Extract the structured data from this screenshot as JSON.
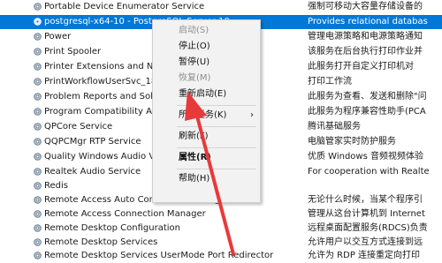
{
  "services": [
    {
      "name": "Portable Device Enumerator Service",
      "desc": "强制可移动大容量存储设备的",
      "selected": false
    },
    {
      "name": "postgresql-x64-10 - PostgreSQL Server 10",
      "desc": "Provides relational databas",
      "selected": true
    },
    {
      "name": "Power",
      "desc": "管理电源策略和电源策略通知",
      "selected": false
    },
    {
      "name": "Print Spooler",
      "desc": "该服务在后台执行打印作业并",
      "selected": false
    },
    {
      "name": "Printer Extensions and Notifications",
      "desc": "此服务打开自定义打印机对",
      "selected": false
    },
    {
      "name": "PrintWorkflowUserSvc_183e",
      "desc": "打印工作流",
      "selected": false
    },
    {
      "name": "Problem Reports and Solutions Control Panel",
      "desc": "此服务为查看、发送和删除\"问",
      "selected": false
    },
    {
      "name": "Program Compatibility Assistant Service",
      "desc": "此服务为程序兼容性助手(PCA",
      "selected": false
    },
    {
      "name": "QPCore Service",
      "desc": "腾讯基础服务",
      "selected": false
    },
    {
      "name": "QQPCMgr RTP Service",
      "desc": "电脑管家实时防护服务",
      "selected": false
    },
    {
      "name": "Quality Windows Audio Video Experience",
      "desc": "优质 Windows 音频视频体验",
      "selected": false
    },
    {
      "name": "Realtek Audio Service",
      "desc": "For cooperation with Realte",
      "selected": false
    },
    {
      "name": "Redis",
      "desc": "",
      "selected": false
    },
    {
      "name": "Remote Access Auto Connection Manager",
      "desc": "无论什么时候，当某个程序引",
      "selected": false
    },
    {
      "name": "Remote Access Connection Manager",
      "desc": "管理从这台计算机到 Internet",
      "selected": false
    },
    {
      "name": "Remote Desktop Configuration",
      "desc": "远程桌面配置服务(RDCS)负责",
      "selected": false
    },
    {
      "name": "Remote Desktop Services",
      "desc": "允许用户以交互方式连接到远",
      "selected": false
    },
    {
      "name": "Remote Desktop Services UserMode Port Redirector",
      "desc": "允许为 RDP 连接重定向打印",
      "selected": false
    }
  ],
  "context_menu": {
    "items": [
      {
        "label": "启动(S)",
        "disabled": true,
        "bold": false,
        "submenu": false
      },
      {
        "label": "停止(O)",
        "disabled": false,
        "bold": false,
        "submenu": false
      },
      {
        "label": "暂停(U)",
        "disabled": false,
        "bold": false,
        "submenu": false
      },
      {
        "label": "恢复(M)",
        "disabled": true,
        "bold": false,
        "submenu": false
      },
      {
        "label": "重新启动(E)",
        "disabled": false,
        "bold": false,
        "submenu": false
      },
      {
        "label": "所有任务(K)",
        "disabled": false,
        "bold": false,
        "submenu": true
      },
      {
        "label": "刷新(F)",
        "disabled": false,
        "bold": false,
        "submenu": false
      },
      {
        "label": "属性(R)",
        "disabled": false,
        "bold": true,
        "submenu": false
      },
      {
        "label": "帮助(H)",
        "disabled": false,
        "bold": false,
        "submenu": false
      }
    ],
    "submenu_arrow": "›"
  },
  "colors": {
    "selection": "#0078d7",
    "annotation_arrow": "#e8393b"
  },
  "icons": {
    "service_icon": "gear-icon",
    "annotation": "red-arrow-annotation"
  }
}
